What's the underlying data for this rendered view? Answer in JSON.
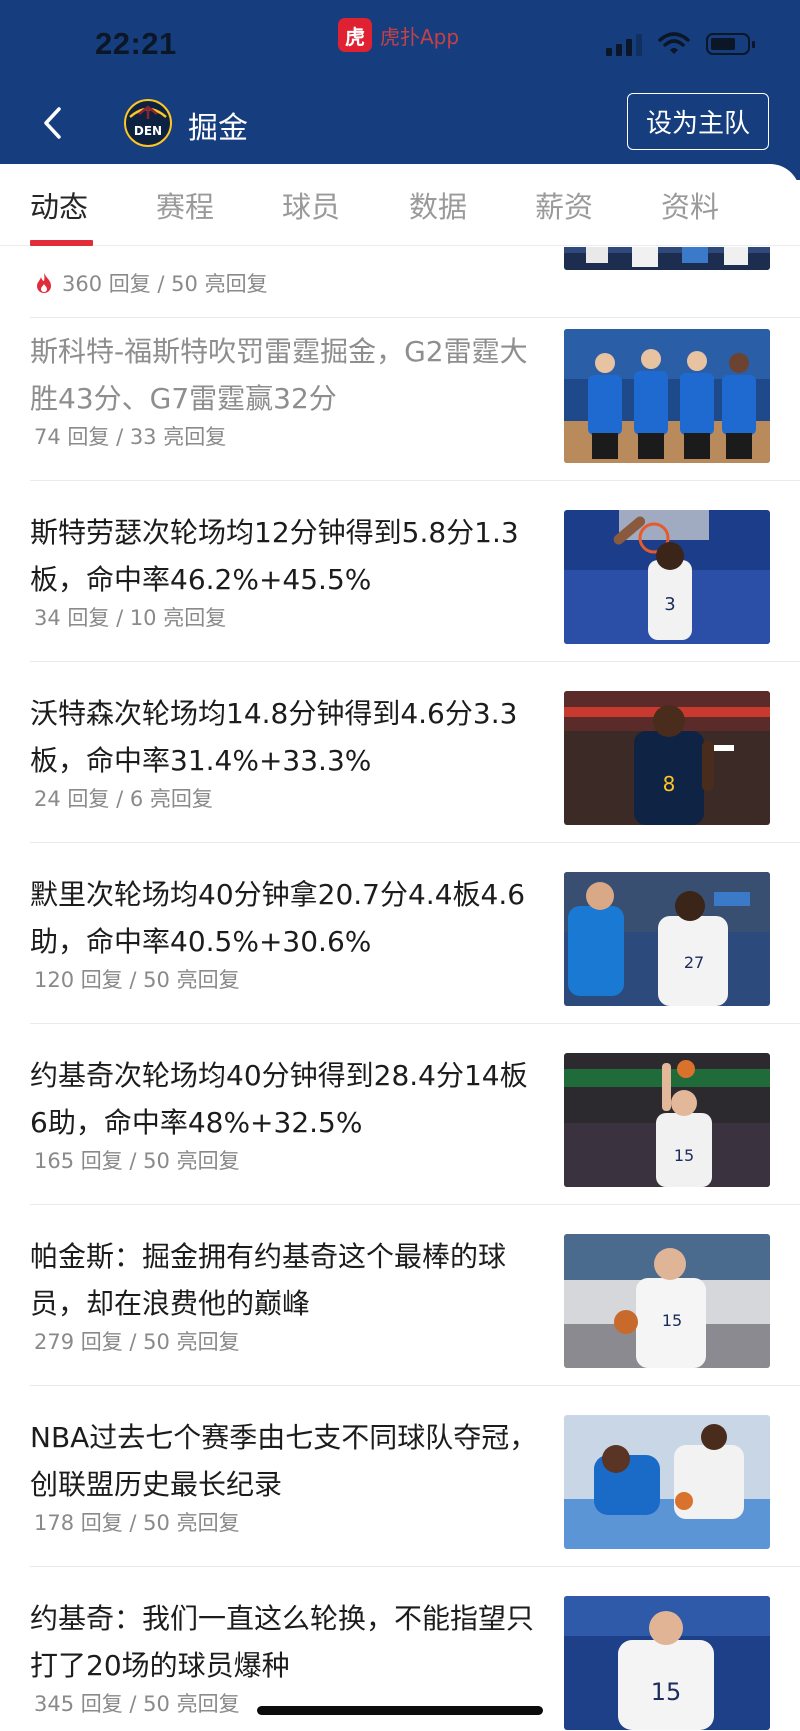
{
  "status_bar": {
    "time": "22:21",
    "app_badge": "虎扑App",
    "app_icon_glyph": "虎"
  },
  "header": {
    "team_logo_text": "DEN",
    "team_name": "掘金",
    "set_home_label": "设为主队"
  },
  "tabs": [
    {
      "label": "动态",
      "active": true
    },
    {
      "label": "赛程"
    },
    {
      "label": "球员"
    },
    {
      "label": "数据"
    },
    {
      "label": "薪资"
    },
    {
      "label": "资料"
    }
  ],
  "colors": {
    "header_bg": "#163e7f",
    "accent": "#e12c3a",
    "text_primary": "#1c1c1c",
    "text_read": "#8e8e8e",
    "meta": "#8a8a8a"
  },
  "feed": [
    {
      "stats": "360 回复 / 50 亮回复",
      "hot": true,
      "thumb": "celebration-photo"
    },
    {
      "title": "斯科特-福斯特吹罚雷霆掘金，G2雷霆大胜43分、G7雷霆赢32分",
      "stats": "74 回复 / 33 亮回复",
      "read": true,
      "thumb": "referees-photo"
    },
    {
      "title": "斯特劳瑟次轮场均12分钟得到5.8分1.3板，命中率46.2%+45.5%",
      "stats": "34 回复 / 10 亮回复",
      "thumb": "dunk-photo"
    },
    {
      "title": "沃特森次轮场均14.8分钟得到4.6分3.3板，命中率31.4%+33.3%",
      "stats": "24 回复 / 6 亮回复",
      "thumb": "watson-photo"
    },
    {
      "title": "默里次轮场均40分钟拿20.7分4.4板4.6助，命中率40.5%+30.6%",
      "stats": "120 回复 / 50 亮回复",
      "thumb": "murray-photo"
    },
    {
      "title": "约基奇次轮场均40分钟得到28.4分14板6助，命中率48%+32.5%",
      "stats": "165 回复 / 50 亮回复",
      "thumb": "jokic-shot-photo"
    },
    {
      "title": "帕金斯：掘金拥有约基奇这个最棒的球员，却在浪费他的巅峰",
      "stats": "279 回复 / 50 亮回复",
      "thumb": "jokic-dribble-photo"
    },
    {
      "title": "NBA过去七个赛季由七支不同球队夺冠，创联盟历史最长纪录",
      "stats": "178 回复 / 50 亮回复",
      "thumb": "loose-ball-photo"
    },
    {
      "title": "约基奇：我们一直这么轮换，不能指望只打了20场的球员爆种",
      "stats": "345 回复 / 50 亮回复",
      "thumb": "jokic-back-photo"
    }
  ]
}
